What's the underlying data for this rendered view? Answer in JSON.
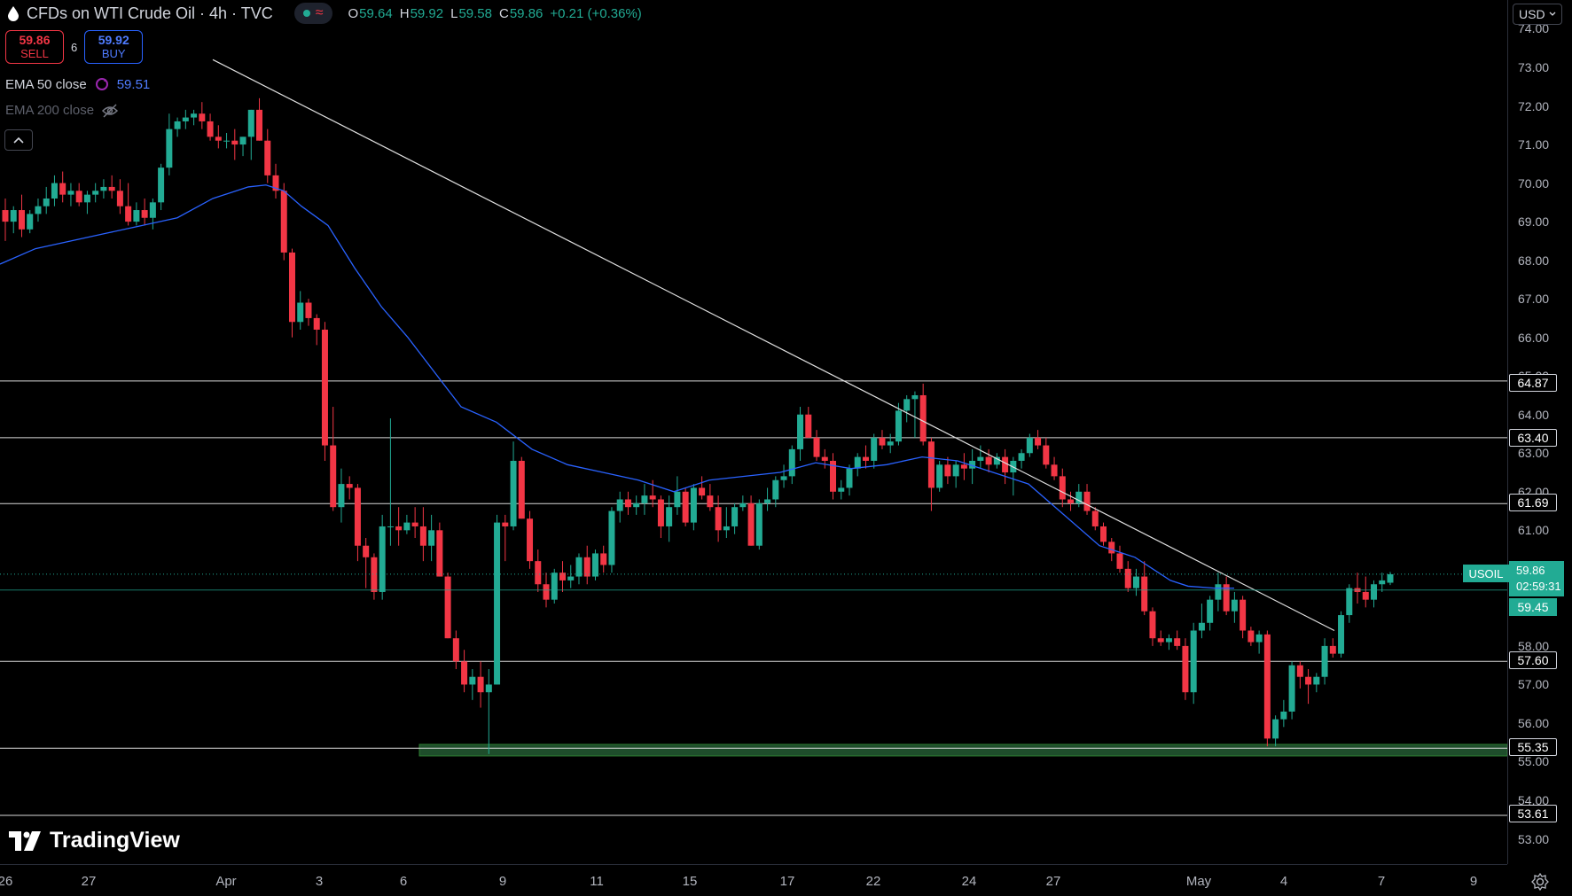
{
  "header": {
    "title": "CFDs on WTI Crude Oil · 4h · TVC",
    "ohlc": [
      {
        "k": "O",
        "v": "59.64"
      },
      {
        "k": "H",
        "v": "59.92"
      },
      {
        "k": "L",
        "v": "59.58"
      },
      {
        "k": "C",
        "v": "59.86"
      },
      {
        "k": "",
        "v": "+0.21 (+0.36%)"
      }
    ]
  },
  "trade": {
    "sell_price": "59.86",
    "sell_label": "SELL",
    "spread": "6",
    "buy_price": "59.92",
    "buy_label": "BUY"
  },
  "indicators": {
    "ema50_label": "EMA 50 close",
    "ema50_value": "59.51",
    "ema200_label": "EMA 200 close"
  },
  "price_axis": {
    "currency": "USD",
    "ticks": [
      "74.00",
      "73.00",
      "72.00",
      "71.00",
      "70.00",
      "69.00",
      "68.00",
      "67.00",
      "66.00",
      "65.00",
      "64.00",
      "63.00",
      "62.00",
      "61.00",
      "60.00",
      "59.00",
      "58.00",
      "57.00",
      "56.00",
      "55.00",
      "54.00",
      "53.00"
    ]
  },
  "levels": [
    "64.87",
    "63.40",
    "61.69",
    "57.60",
    "55.35",
    "53.61"
  ],
  "current": {
    "symbol": "USOIL",
    "price": "59.86",
    "countdown": "02:59:31",
    "ema_tag": "59.45"
  },
  "time_axis": [
    "26",
    "27",
    "Apr",
    "3",
    "6",
    "9",
    "11",
    "15",
    "17",
    "22",
    "24",
    "27",
    "May",
    "4",
    "7",
    "9"
  ],
  "branding": {
    "logo_text": "TradingView"
  },
  "colors": {
    "up": "#22ab94",
    "down": "#f23645",
    "ema": "#2962ff",
    "line": "#ffffff",
    "support_zone": "#1e4d2b"
  },
  "chart_data": {
    "type": "candlestick",
    "title": "CFDs on WTI Crude Oil · 4h · TVC",
    "ylim": [
      52.2,
      74.4
    ],
    "candles": [
      [
        69.3,
        69.6,
        68.5,
        69.0
      ],
      [
        69.0,
        69.4,
        68.7,
        69.3
      ],
      [
        69.3,
        69.7,
        68.6,
        68.8
      ],
      [
        68.8,
        69.3,
        68.7,
        69.2
      ],
      [
        69.2,
        69.6,
        69.0,
        69.4
      ],
      [
        69.4,
        69.9,
        69.2,
        69.6
      ],
      [
        69.6,
        70.2,
        69.4,
        70.0
      ],
      [
        70.0,
        70.3,
        69.5,
        69.7
      ],
      [
        69.7,
        70.0,
        69.4,
        69.8
      ],
      [
        69.8,
        70.0,
        69.4,
        69.5
      ],
      [
        69.5,
        69.8,
        69.2,
        69.7
      ],
      [
        69.7,
        70.0,
        69.5,
        69.8
      ],
      [
        69.8,
        70.1,
        69.6,
        69.9
      ],
      [
        69.9,
        70.2,
        69.6,
        69.8
      ],
      [
        69.8,
        70.1,
        69.2,
        69.4
      ],
      [
        69.4,
        70.0,
        68.9,
        69.0
      ],
      [
        69.0,
        69.5,
        68.9,
        69.3
      ],
      [
        69.3,
        69.6,
        68.9,
        69.1
      ],
      [
        69.1,
        69.6,
        68.8,
        69.5
      ],
      [
        69.5,
        70.5,
        69.3,
        70.4
      ],
      [
        70.4,
        71.8,
        70.2,
        71.4
      ],
      [
        71.4,
        71.7,
        71.2,
        71.6
      ],
      [
        71.6,
        71.9,
        71.4,
        71.7
      ],
      [
        71.7,
        71.9,
        71.5,
        71.8
      ],
      [
        71.8,
        72.1,
        71.4,
        71.6
      ],
      [
        71.6,
        71.8,
        71.1,
        71.2
      ],
      [
        71.2,
        71.5,
        70.9,
        71.1
      ],
      [
        71.1,
        71.3,
        70.9,
        71.1
      ],
      [
        71.1,
        71.4,
        70.6,
        71.0
      ],
      [
        71.0,
        71.2,
        70.7,
        71.2
      ],
      [
        71.2,
        71.9,
        70.6,
        71.9
      ],
      [
        71.9,
        72.2,
        71.1,
        71.1
      ],
      [
        71.1,
        71.4,
        70.0,
        70.2
      ],
      [
        70.2,
        70.5,
        69.6,
        69.8
      ],
      [
        69.8,
        70.0,
        68.0,
        68.2
      ],
      [
        68.2,
        68.3,
        66.0,
        66.4
      ],
      [
        66.4,
        67.2,
        66.2,
        66.9
      ],
      [
        66.9,
        67.0,
        66.3,
        66.5
      ],
      [
        66.5,
        66.6,
        65.8,
        66.2
      ],
      [
        66.2,
        66.4,
        62.8,
        63.2
      ],
      [
        63.2,
        64.2,
        61.5,
        61.6
      ],
      [
        61.6,
        62.6,
        61.2,
        62.2
      ],
      [
        62.2,
        62.4,
        61.8,
        62.1
      ],
      [
        62.1,
        62.2,
        60.2,
        60.6
      ],
      [
        60.6,
        60.8,
        59.5,
        60.3
      ],
      [
        60.3,
        60.4,
        59.2,
        59.4
      ],
      [
        59.4,
        61.4,
        59.2,
        61.1
      ],
      [
        61.1,
        63.9,
        60.6,
        61.1
      ],
      [
        61.1,
        61.6,
        60.6,
        61.0
      ],
      [
        61.0,
        61.4,
        60.9,
        61.2
      ],
      [
        61.2,
        61.6,
        60.8,
        61.1
      ],
      [
        61.1,
        61.6,
        60.2,
        60.6
      ],
      [
        60.6,
        61.4,
        60.2,
        61.0
      ],
      [
        61.0,
        61.2,
        59.8,
        59.8
      ],
      [
        59.8,
        59.9,
        58.2,
        58.2
      ],
      [
        58.2,
        58.4,
        57.4,
        57.6
      ],
      [
        57.6,
        57.9,
        56.8,
        57.0
      ],
      [
        57.0,
        57.4,
        56.6,
        57.2
      ],
      [
        57.2,
        57.6,
        56.4,
        56.8
      ],
      [
        56.8,
        57.4,
        55.2,
        57.0
      ],
      [
        57.0,
        61.4,
        57.0,
        61.2
      ],
      [
        61.2,
        61.4,
        60.2,
        61.1
      ],
      [
        61.1,
        63.3,
        61.0,
        62.8
      ],
      [
        62.8,
        62.9,
        61.3,
        61.3
      ],
      [
        61.3,
        61.5,
        60.0,
        60.2
      ],
      [
        60.2,
        60.5,
        59.4,
        59.6
      ],
      [
        59.6,
        59.9,
        59.0,
        59.2
      ],
      [
        59.2,
        60.0,
        59.1,
        59.9
      ],
      [
        59.9,
        60.2,
        59.4,
        59.7
      ],
      [
        59.7,
        60.1,
        59.5,
        59.8
      ],
      [
        59.8,
        60.4,
        59.6,
        60.3
      ],
      [
        60.3,
        60.6,
        59.6,
        59.8
      ],
      [
        59.8,
        60.5,
        59.7,
        60.4
      ],
      [
        60.4,
        60.6,
        59.9,
        60.1
      ],
      [
        60.1,
        61.6,
        59.9,
        61.5
      ],
      [
        61.5,
        62.0,
        61.2,
        61.8
      ],
      [
        61.8,
        62.0,
        61.4,
        61.6
      ],
      [
        61.6,
        61.9,
        61.4,
        61.7
      ],
      [
        61.7,
        62.2,
        61.4,
        61.9
      ],
      [
        61.9,
        62.3,
        61.6,
        61.8
      ],
      [
        61.8,
        61.9,
        60.8,
        61.1
      ],
      [
        61.1,
        61.9,
        60.7,
        61.6
      ],
      [
        61.6,
        62.4,
        61.4,
        62.0
      ],
      [
        62.0,
        62.1,
        61.1,
        61.2
      ],
      [
        61.2,
        62.2,
        61.0,
        62.1
      ],
      [
        62.1,
        62.4,
        61.8,
        61.9
      ],
      [
        61.9,
        62.2,
        61.5,
        61.6
      ],
      [
        61.6,
        61.9,
        60.7,
        61.0
      ],
      [
        61.0,
        61.6,
        60.8,
        61.1
      ],
      [
        61.1,
        61.7,
        60.9,
        61.6
      ],
      [
        61.6,
        61.9,
        61.5,
        61.7
      ],
      [
        61.7,
        61.9,
        60.6,
        60.6
      ],
      [
        60.6,
        61.8,
        60.5,
        61.7
      ],
      [
        61.7,
        62.1,
        61.5,
        61.8
      ],
      [
        61.8,
        62.4,
        61.6,
        62.3
      ],
      [
        62.3,
        62.7,
        62.1,
        62.4
      ],
      [
        62.4,
        63.2,
        62.2,
        63.1
      ],
      [
        63.1,
        64.2,
        62.8,
        64.0
      ],
      [
        64.0,
        64.2,
        63.4,
        63.4
      ],
      [
        63.4,
        63.6,
        62.8,
        62.9
      ],
      [
        62.9,
        63.1,
        62.6,
        62.8
      ],
      [
        62.8,
        63.0,
        61.8,
        62.0
      ],
      [
        62.0,
        62.3,
        61.8,
        62.1
      ],
      [
        62.1,
        62.7,
        61.9,
        62.6
      ],
      [
        62.6,
        63.0,
        62.4,
        62.9
      ],
      [
        62.9,
        63.2,
        62.6,
        62.8
      ],
      [
        62.8,
        63.5,
        62.6,
        63.4
      ],
      [
        63.4,
        63.6,
        63.1,
        63.2
      ],
      [
        63.2,
        63.5,
        63.0,
        63.3
      ],
      [
        63.3,
        64.3,
        63.2,
        64.1
      ],
      [
        64.1,
        64.5,
        63.8,
        64.4
      ],
      [
        64.4,
        64.6,
        63.4,
        64.5
      ],
      [
        64.5,
        64.8,
        63.2,
        63.3
      ],
      [
        63.3,
        63.4,
        61.5,
        62.1
      ],
      [
        62.1,
        62.8,
        62.0,
        62.7
      ],
      [
        62.7,
        62.9,
        62.2,
        62.4
      ],
      [
        62.4,
        62.8,
        62.1,
        62.7
      ],
      [
        62.7,
        63.0,
        62.3,
        62.6
      ],
      [
        62.6,
        63.1,
        62.2,
        62.8
      ],
      [
        62.8,
        63.2,
        62.6,
        62.9
      ],
      [
        62.9,
        63.1,
        62.5,
        62.7
      ],
      [
        62.7,
        63.0,
        62.6,
        62.9
      ],
      [
        62.9,
        63.1,
        62.2,
        62.5
      ],
      [
        62.5,
        62.9,
        61.9,
        62.8
      ],
      [
        62.8,
        63.1,
        62.6,
        63.0
      ],
      [
        63.0,
        63.5,
        62.9,
        63.4
      ],
      [
        63.4,
        63.6,
        63.1,
        63.2
      ],
      [
        63.2,
        63.4,
        62.6,
        62.7
      ],
      [
        62.7,
        62.9,
        62.3,
        62.4
      ],
      [
        62.4,
        62.6,
        61.6,
        61.8
      ],
      [
        61.8,
        62.0,
        61.5,
        61.7
      ],
      [
        61.7,
        62.2,
        61.6,
        62.0
      ],
      [
        62.0,
        62.2,
        61.4,
        61.5
      ],
      [
        61.5,
        61.6,
        61.0,
        61.1
      ],
      [
        61.1,
        61.2,
        60.6,
        60.7
      ],
      [
        60.7,
        60.8,
        60.2,
        60.4
      ],
      [
        60.4,
        60.6,
        59.9,
        60.0
      ],
      [
        60.0,
        60.2,
        59.4,
        59.5
      ],
      [
        59.5,
        60.0,
        59.3,
        59.8
      ],
      [
        59.8,
        60.2,
        58.8,
        58.9
      ],
      [
        58.9,
        59.0,
        58.0,
        58.2
      ],
      [
        58.2,
        58.4,
        58.0,
        58.1
      ],
      [
        58.1,
        58.3,
        57.9,
        58.2
      ],
      [
        58.2,
        58.4,
        57.9,
        58.0
      ],
      [
        58.0,
        58.2,
        56.6,
        56.8
      ],
      [
        56.8,
        58.6,
        56.5,
        58.4
      ],
      [
        58.4,
        59.1,
        58.2,
        58.6
      ],
      [
        58.6,
        59.3,
        58.4,
        59.2
      ],
      [
        59.2,
        59.9,
        58.9,
        59.6
      ],
      [
        59.6,
        59.8,
        58.8,
        58.9
      ],
      [
        58.9,
        59.4,
        58.6,
        59.2
      ],
      [
        59.2,
        59.3,
        58.2,
        58.4
      ],
      [
        58.4,
        58.5,
        58.0,
        58.1
      ],
      [
        58.1,
        58.4,
        57.8,
        58.3
      ],
      [
        58.3,
        58.4,
        55.4,
        55.6
      ],
      [
        55.6,
        56.2,
        55.4,
        56.1
      ],
      [
        56.1,
        56.6,
        55.9,
        56.3
      ],
      [
        56.3,
        57.6,
        56.1,
        57.5
      ],
      [
        57.5,
        57.6,
        56.9,
        57.2
      ],
      [
        57.2,
        57.4,
        56.5,
        57.0
      ],
      [
        57.0,
        57.3,
        56.8,
        57.2
      ],
      [
        57.2,
        58.2,
        57.0,
        58.0
      ],
      [
        58.0,
        58.2,
        57.7,
        57.8
      ],
      [
        57.8,
        58.9,
        57.7,
        58.8
      ],
      [
        58.8,
        59.6,
        58.6,
        59.5
      ],
      [
        59.5,
        59.9,
        59.1,
        59.4
      ],
      [
        59.4,
        59.8,
        59.0,
        59.2
      ],
      [
        59.2,
        59.7,
        59.0,
        59.6
      ],
      [
        59.6,
        59.9,
        59.4,
        59.7
      ],
      [
        59.64,
        59.92,
        59.58,
        59.86
      ]
    ],
    "ema50": [
      [
        0,
        67.9
      ],
      [
        40,
        68.3
      ],
      [
        80,
        68.5
      ],
      [
        120,
        68.7
      ],
      [
        160,
        68.9
      ],
      [
        200,
        69.1
      ],
      [
        240,
        69.6
      ],
      [
        280,
        69.9
      ],
      [
        300,
        69.95
      ],
      [
        320,
        69.8
      ],
      [
        340,
        69.4
      ],
      [
        370,
        68.9
      ],
      [
        400,
        67.8
      ],
      [
        430,
        66.8
      ],
      [
        460,
        66.0
      ],
      [
        490,
        65.1
      ],
      [
        520,
        64.2
      ],
      [
        560,
        63.8
      ],
      [
        600,
        63.1
      ],
      [
        640,
        62.7
      ],
      [
        680,
        62.5
      ],
      [
        720,
        62.3
      ],
      [
        760,
        62.0
      ],
      [
        800,
        62.3
      ],
      [
        840,
        62.4
      ],
      [
        880,
        62.5
      ],
      [
        920,
        62.75
      ],
      [
        960,
        62.6
      ],
      [
        1000,
        62.7
      ],
      [
        1040,
        62.9
      ],
      [
        1080,
        62.8
      ],
      [
        1120,
        62.5
      ],
      [
        1160,
        62.2
      ],
      [
        1200,
        61.4
      ],
      [
        1240,
        60.6
      ],
      [
        1280,
        60.3
      ],
      [
        1320,
        59.7
      ],
      [
        1340,
        59.55
      ],
      [
        1370,
        59.5
      ],
      [
        1392,
        59.5
      ]
    ],
    "trendline": [
      [
        240,
        73.2
      ],
      [
        1505,
        58.4
      ]
    ],
    "horizontal_levels": [
      64.87,
      63.4,
      61.69,
      57.6,
      55.35,
      53.61
    ],
    "support_zone": [
      55.15,
      55.45
    ]
  }
}
